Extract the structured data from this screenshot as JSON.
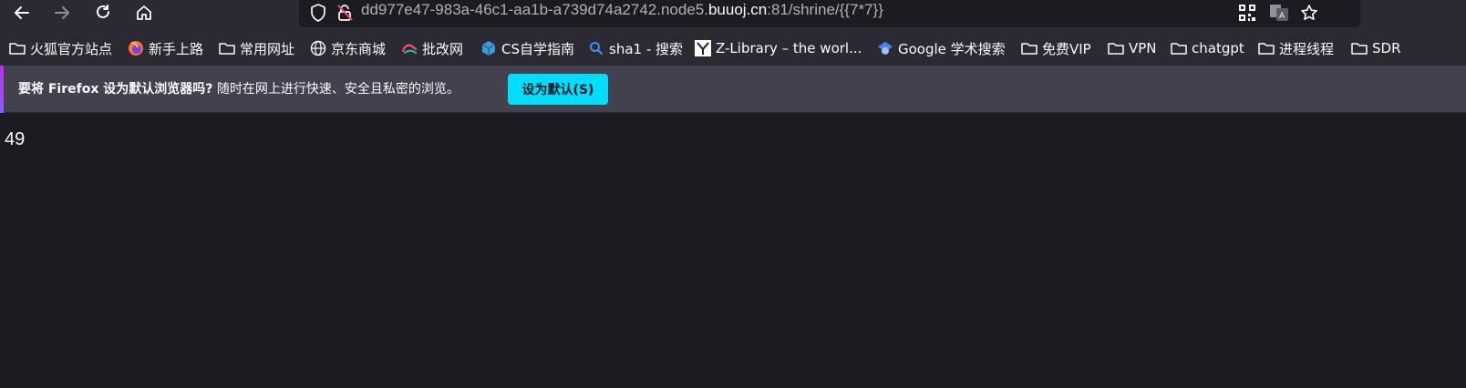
{
  "browser": {
    "nav": {
      "back_icon": "arrow-left-icon",
      "forward_icon": "arrow-right-icon",
      "reload_icon": "reload-icon",
      "home_icon": "home-icon"
    },
    "urlbar": {
      "url_prefix": "dd977e47-983a-46c1-aa1b-a739d74a2742.node5.",
      "url_domain": "buuoj.cn",
      "url_suffix": ":81/shrine/{{7*7}}",
      "icons": [
        "shield-icon",
        "insecure-lock-icon",
        "qr-code-icon",
        "translate-icon",
        "bookmark-star-icon"
      ]
    },
    "bookmarks": [
      {
        "label": "火狐官方站点",
        "icon": "folder-icon"
      },
      {
        "label": "新手上路",
        "icon": "firefox-icon"
      },
      {
        "label": "常用网址",
        "icon": "folder-icon"
      },
      {
        "label": "京东商城",
        "icon": "globe-icon"
      },
      {
        "label": "批改网",
        "icon": "pigai-icon"
      },
      {
        "label": "CS自学指南",
        "icon": "cube-icon"
      },
      {
        "label": "sha1 - 搜索",
        "icon": "search-icon"
      },
      {
        "label": "Z-Library – the worl...",
        "icon": "zlibrary-icon"
      },
      {
        "label": "Google 学术搜索",
        "icon": "scholar-icon"
      },
      {
        "label": "免费VIP",
        "icon": "folder-icon"
      },
      {
        "label": "VPN",
        "icon": "folder-icon"
      },
      {
        "label": "chatgpt",
        "icon": "folder-icon"
      },
      {
        "label": "进程线程",
        "icon": "folder-icon"
      },
      {
        "label": "SDR",
        "icon": "folder-icon"
      }
    ],
    "notification": {
      "bold_text": "要将 Firefox 设为默认浏览器吗?",
      "text": " 随时在网上进行快速、安全且私密的浏览。",
      "button_label": "设为默认(S)",
      "accent_color": "#00ddff"
    }
  },
  "page": {
    "output": "49"
  }
}
